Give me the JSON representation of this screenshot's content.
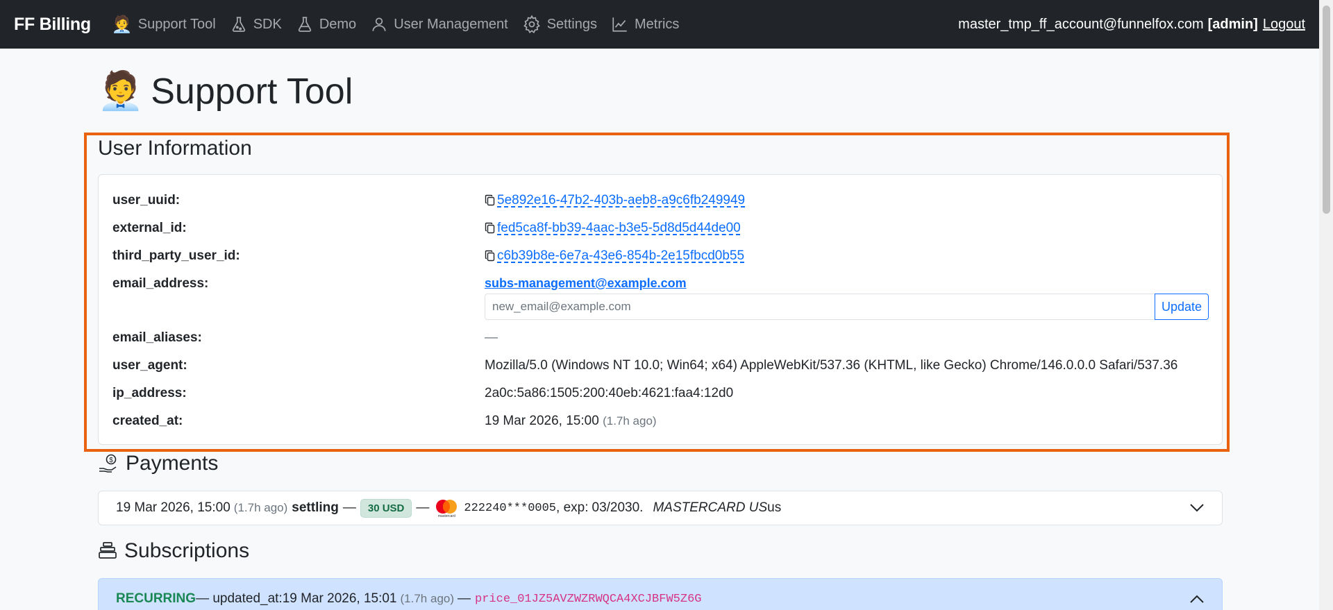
{
  "nav": {
    "brand": "FF Billing",
    "items": [
      {
        "label": "Support Tool",
        "icon": "support-agent-icon"
      },
      {
        "label": "SDK",
        "icon": "flask-icon"
      },
      {
        "label": "Demo",
        "icon": "flask-icon"
      },
      {
        "label": "User Management",
        "icon": "user-icon"
      },
      {
        "label": "Settings",
        "icon": "gear-icon"
      },
      {
        "label": "Metrics",
        "icon": "chart-line-icon"
      }
    ],
    "account": "master_tmp_ff_account@funnelfox.com",
    "role": "[admin]",
    "logout": "Logout"
  },
  "page": {
    "title": "Support Tool",
    "title_emoji": "🧑‍💼"
  },
  "user_info": {
    "title": "User Information",
    "labels": {
      "user_uuid": "user_uuid:",
      "external_id": "external_id:",
      "third_party_user_id": "third_party_user_id:",
      "email_address": "email_address:",
      "email_aliases": "email_aliases:",
      "user_agent": "user_agent:",
      "ip_address": "ip_address:",
      "created_at": "created_at:"
    },
    "user_uuid": "5e892e16-47b2-403b-aeb8-a9c6fb249949",
    "external_id": "fed5ca8f-bb39-4aac-b3e5-5d8d5d44de00",
    "third_party_user_id": "c6b39b8e-6e7a-43e6-854b-2e15fbcd0b55",
    "email_address": "subs-management@example.com",
    "email_placeholder": "new_email@example.com",
    "update_label": "Update",
    "email_aliases": "—",
    "user_agent": "Mozilla/5.0 (Windows NT 10.0; Win64; x64) AppleWebKit/537.36 (KHTML, like Gecko) Chrome/146.0.0.0 Safari/537.36",
    "ip_address": "2a0c:5a86:1505:200:40eb:4621:faa4:12d0",
    "created_at": "19 Mar 2026, 15:00",
    "created_ago": "(1.7h ago)"
  },
  "payments": {
    "title": "Payments",
    "item": {
      "date": "19 Mar 2026, 15:00",
      "ago": "(1.7h ago)",
      "status": "settling",
      "dash1": "—",
      "amount": "30 USD",
      "dash2": "—",
      "card_brand_small": "mastercard",
      "card_number": "222240***0005",
      "exp_label": ", exp:",
      "exp": "03/2030.",
      "card_desc": "MASTERCARD US",
      "card_desc_suffix": "us"
    }
  },
  "subscriptions": {
    "title": "Subscriptions",
    "item": {
      "type": "RECURRING",
      "updated_label": "— updated_at:",
      "updated_at": "19 Mar 2026, 15:01",
      "ago": "(1.7h ago)",
      "dash": "—",
      "price_id": "price_01JZ5AVZWZRWQCA4XCJBFW5Z6G"
    }
  },
  "colors": {
    "navbar": "#212529",
    "highlight": "#e8620f",
    "link": "#0d6efd",
    "badge_bg": "#d1e7dd",
    "recurring": "#198754",
    "price": "#d63384",
    "subscription_bg": "#cfe2ff"
  }
}
